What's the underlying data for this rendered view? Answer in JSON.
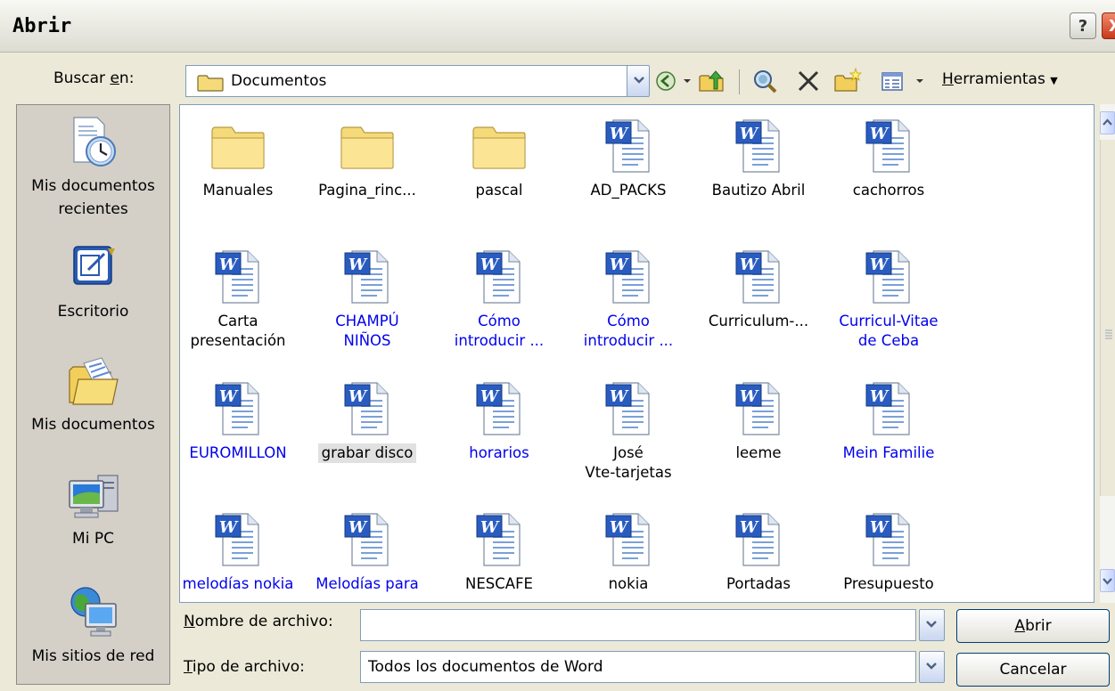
{
  "window": {
    "title": "Abrir",
    "help_glyph": "?",
    "close_glyph": "X"
  },
  "lookin": {
    "label_pre": "Buscar ",
    "label_accel": "e",
    "label_post": "n:",
    "value": "Documentos"
  },
  "toolbar": {
    "tools_label_accel": "H",
    "tools_label_rest": "erramientas",
    "icons": [
      "back-icon",
      "up-folder-icon",
      "search-web-icon",
      "delete-icon",
      "new-folder-icon",
      "views-icon"
    ]
  },
  "places": [
    {
      "label_l1": "Mis documentos",
      "label_l2": "recientes",
      "icon": "recent-documents-icon"
    },
    {
      "label_l1": "Escritorio",
      "label_l2": "",
      "icon": "desktop-icon"
    },
    {
      "label_l1": "Mis documentos",
      "label_l2": "",
      "icon": "my-documents-icon"
    },
    {
      "label_l1": "Mi PC",
      "label_l2": "",
      "icon": "my-computer-icon"
    },
    {
      "label_l1": "Mis sitios de red",
      "label_l2": "",
      "icon": "network-places-icon"
    }
  ],
  "files": [
    {
      "l1": "Manuales",
      "l2": "",
      "type": "folder",
      "blue": false
    },
    {
      "l1": "Pagina_rinc...",
      "l2": "",
      "type": "folder",
      "blue": false
    },
    {
      "l1": "pascal",
      "l2": "",
      "type": "folder",
      "blue": false
    },
    {
      "l1": "AD_PACKS",
      "l2": "",
      "type": "word",
      "blue": false
    },
    {
      "l1": "Bautizo Abril",
      "l2": "",
      "type": "word",
      "blue": false
    },
    {
      "l1": "cachorros",
      "l2": "",
      "type": "word",
      "blue": false
    },
    {
      "l1": "Carta",
      "l2": "presentación",
      "type": "word",
      "blue": false
    },
    {
      "l1": "CHAMPÚ",
      "l2": "NIÑOS",
      "type": "word",
      "blue": true
    },
    {
      "l1": "Cómo",
      "l2": "introducir ...",
      "type": "word",
      "blue": true
    },
    {
      "l1": "Cómo",
      "l2": "introducir ...",
      "type": "word",
      "blue": true
    },
    {
      "l1": "Curriculum-...",
      "l2": "",
      "type": "word",
      "blue": false
    },
    {
      "l1": "Curricul-Vitae",
      "l2": "de Ceba",
      "type": "word",
      "blue": true
    },
    {
      "l1": "EUROMILLON",
      "l2": "",
      "type": "word",
      "blue": true
    },
    {
      "l1": "grabar disco",
      "l2": "",
      "type": "word",
      "blue": false,
      "selected": true
    },
    {
      "l1": "horarios",
      "l2": "",
      "type": "word",
      "blue": true
    },
    {
      "l1": "José",
      "l2": "Vte-tarjetas",
      "type": "word",
      "blue": false
    },
    {
      "l1": "leeme",
      "l2": "",
      "type": "word",
      "blue": false
    },
    {
      "l1": "Mein Familie",
      "l2": "",
      "type": "word",
      "blue": true
    },
    {
      "l1": "melodías nokia",
      "l2": "",
      "type": "word",
      "blue": true
    },
    {
      "l1": "Melodías para",
      "l2": "",
      "type": "word",
      "blue": true
    },
    {
      "l1": "NESCAFE",
      "l2": "",
      "type": "word",
      "blue": false
    },
    {
      "l1": "nokia",
      "l2": "",
      "type": "word",
      "blue": false
    },
    {
      "l1": "Portadas",
      "l2": "",
      "type": "word",
      "blue": false
    },
    {
      "l1": "Presupuesto",
      "l2": "",
      "type": "word",
      "blue": false
    }
  ],
  "filename": {
    "label_accel": "N",
    "label_rest": "ombre de archivo:",
    "value": ""
  },
  "filetype": {
    "label_accel": "T",
    "label_rest": "ipo de archivo:",
    "value": "Todos los documentos de Word"
  },
  "buttons": {
    "open_accel": "A",
    "open_rest": "brir",
    "cancel": "Cancelar"
  }
}
